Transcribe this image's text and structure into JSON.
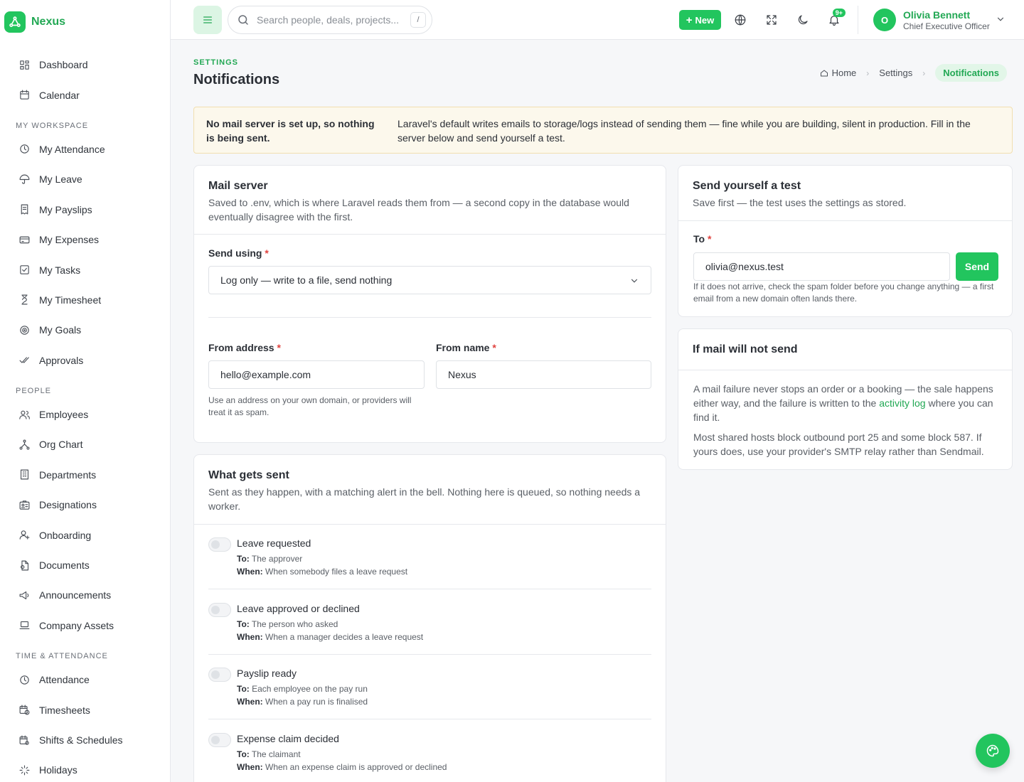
{
  "brand": {
    "name": "Nexus"
  },
  "sidebar": {
    "items_top": [
      {
        "label": "Dashboard",
        "icon": "dashboard-icon"
      },
      {
        "label": "Calendar",
        "icon": "calendar-icon"
      }
    ],
    "sections": [
      {
        "title": "MY WORKSPACE",
        "items": [
          {
            "label": "My Attendance",
            "icon": "clock-icon"
          },
          {
            "label": "My Leave",
            "icon": "umbrella-icon"
          },
          {
            "label": "My Payslips",
            "icon": "receipt-icon"
          },
          {
            "label": "My Expenses",
            "icon": "credit-card-icon"
          },
          {
            "label": "My Tasks",
            "icon": "checkbox-icon"
          },
          {
            "label": "My Timesheet",
            "icon": "hourglass-icon"
          },
          {
            "label": "My Goals",
            "icon": "target-icon"
          },
          {
            "label": "Approvals",
            "icon": "double-check-icon"
          }
        ]
      },
      {
        "title": "PEOPLE",
        "items": [
          {
            "label": "Employees",
            "icon": "users-icon"
          },
          {
            "label": "Org Chart",
            "icon": "org-chart-icon"
          },
          {
            "label": "Departments",
            "icon": "building-icon"
          },
          {
            "label": "Designations",
            "icon": "id-badge-icon"
          },
          {
            "label": "Onboarding",
            "icon": "user-plus-icon"
          },
          {
            "label": "Documents",
            "icon": "document-icon"
          },
          {
            "label": "Announcements",
            "icon": "megaphone-icon"
          },
          {
            "label": "Company Assets",
            "icon": "laptop-icon"
          }
        ]
      },
      {
        "title": "TIME & ATTENDANCE",
        "items": [
          {
            "label": "Attendance",
            "icon": "clock-icon"
          },
          {
            "label": "Timesheets",
            "icon": "calendar-clock-icon"
          },
          {
            "label": "Shifts & Schedules",
            "icon": "calendar-gear-icon"
          },
          {
            "label": "Holidays",
            "icon": "sparkle-icon"
          }
        ]
      }
    ]
  },
  "topbar": {
    "search_placeholder": "Search people, deals, projects...",
    "search_shortcut": "/",
    "new_label": "New",
    "notification_badge": "9+",
    "user_initial": "O",
    "user_name": "Olivia Bennett",
    "user_role": "Chief Executive Officer"
  },
  "page": {
    "overline": "SETTINGS",
    "title": "Notifications",
    "breadcrumb": [
      "Home",
      "Settings",
      "Notifications"
    ]
  },
  "alert": {
    "strong": "No mail server is set up, so nothing is being sent.",
    "body": "Laravel's default writes emails to storage/logs instead of sending them — fine while you are building, silent in production. Fill in the server below and send yourself a test."
  },
  "mail_server": {
    "title": "Mail server",
    "subtitle": "Saved to .env, which is where Laravel reads them from — a second copy in the database would eventually disagree with the first.",
    "send_using_label": "Send using",
    "send_using_value": "Log only — write to a file, send nothing",
    "from_address_label": "From address",
    "from_address_value": "hello@example.com",
    "from_address_hint": "Use an address on your own domain, or providers will treat it as spam.",
    "from_name_label": "From name",
    "from_name_value": "Nexus"
  },
  "what_gets_sent": {
    "title": "What gets sent",
    "subtitle": "Sent as they happen, with a matching alert in the bell. Nothing here is queued, so nothing needs a worker.",
    "to_prefix": "To:",
    "when_prefix": "When:",
    "items": [
      {
        "title": "Leave requested",
        "to": "The approver",
        "when": "When somebody files a leave request",
        "enabled": false
      },
      {
        "title": "Leave approved or declined",
        "to": "The person who asked",
        "when": "When a manager decides a leave request",
        "enabled": false
      },
      {
        "title": "Payslip ready",
        "to": "Each employee on the pay run",
        "when": "When a pay run is finalised",
        "enabled": false
      },
      {
        "title": "Expense claim decided",
        "to": "The claimant",
        "when": "When an expense claim is approved or declined",
        "enabled": false
      }
    ]
  },
  "test_card": {
    "title": "Send yourself a test",
    "subtitle": "Save first — the test uses the settings as stored.",
    "to_label": "To",
    "to_value": "olivia@nexus.test",
    "send_label": "Send",
    "hint": "If it does not arrive, check the spam folder before you change anything — a first email from a new domain often lands there."
  },
  "help_card": {
    "title": "If mail will not send",
    "p1_before": "A mail failure never stops an order or a booking — the sale happens either way, and the failure is written to the",
    "p1_link": "activity log",
    "p1_after": "where you can find it.",
    "p2": "Most shared hosts block outbound port 25 and some block 587. If yours does, use your provider's SMTP relay rather than Sendmail."
  },
  "colors": {
    "accent": "#22c55e",
    "accent_text": "#22a854",
    "alert_bg": "#fcf8ec",
    "required": "#e0433f"
  }
}
